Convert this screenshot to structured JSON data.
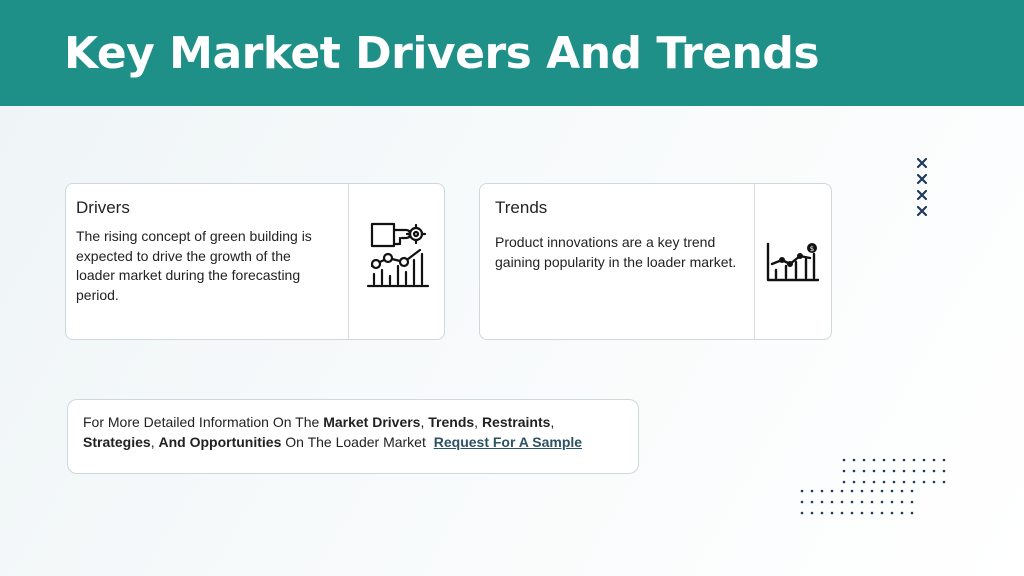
{
  "header": {
    "title": "Key Market Drivers And Trends"
  },
  "drivers": {
    "title": "Drivers",
    "body": "The rising concept of green building is expected to drive the growth of the loader market during the forecasting period.",
    "icon": "green-building-gear-icon"
  },
  "trends": {
    "title": "Trends",
    "body": "Product innovations are a key trend gaining popularity in the loader market.",
    "icon": "growth-chart-icon"
  },
  "info": {
    "prefix": "For More Detailed Information On The ",
    "b1": "Market Drivers",
    "sep1": ", ",
    "b2": "Trends",
    "sep2": ", ",
    "b3": "Restraints",
    "sep3": ", ",
    "b4": "Strategies",
    "sep4": ", ",
    "b5": "And Opportunities",
    "mid": " On The Loader Market ",
    "link": "Request For A Sample"
  },
  "colors": {
    "header": "#1e9088",
    "accent_dark": "#1f3a5a",
    "link": "#2c5364"
  }
}
